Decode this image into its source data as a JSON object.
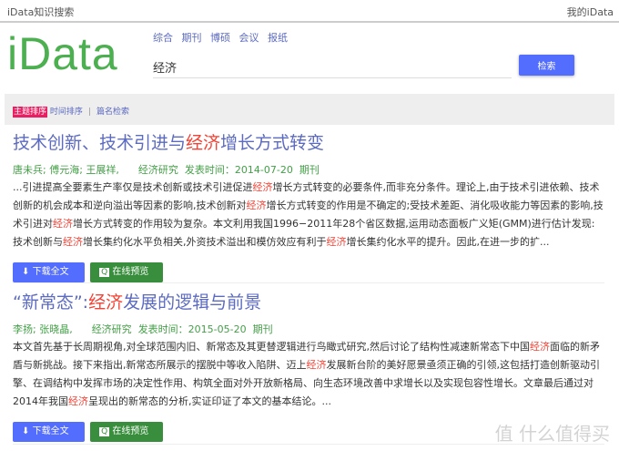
{
  "topbar": {
    "app_title": "iData知识搜索",
    "account": "我的iData"
  },
  "logo": "iData",
  "nav": [
    "综合",
    "期刊",
    "博硕",
    "会议",
    "报纸"
  ],
  "search": {
    "value": "经济",
    "button": "检索"
  },
  "sort": {
    "active": "主题排序",
    "time": "时间排序",
    "sep": "|",
    "title_search": "篇名检索"
  },
  "buttons": {
    "download": "下载全文",
    "preview": "在线预览"
  },
  "results": [
    {
      "title": [
        {
          "t": "技术创新、技术引进与"
        },
        {
          "t": "经济",
          "hl": true
        },
        {
          "t": "增长方式转变"
        }
      ],
      "authors": "唐未兵; 傅元海; 王展祥,",
      "journal": "经济研究",
      "date": "发表时间：2014-07-20",
      "type": "期刊",
      "abstract": [
        {
          "t": "...引进提高全要素生产率仅是技术创新或技术引进促进"
        },
        {
          "t": "经济",
          "hl": true
        },
        {
          "t": "增长方式转变的必要条件,而非充分条件。理论上,由于技术引进依赖、技术创新的机会成本和逆向溢出等因素的影响,技术创新对"
        },
        {
          "t": "经济",
          "hl": true
        },
        {
          "t": "增长方式转变的作用是不确定的;受技术差距、消化吸收能力等因素的影响,技术引进对"
        },
        {
          "t": "经济",
          "hl": true
        },
        {
          "t": "增长方式转变的作用较为复杂。本文利用我国1996−2011年28个省区数据,运用动态面板广义矩(GMM)进行估计发现:技术创新与"
        },
        {
          "t": "经济",
          "hl": true
        },
        {
          "t": "增长集约化水平负相关,外资技术溢出和模仿效应有利于"
        },
        {
          "t": "经济",
          "hl": true
        },
        {
          "t": "增长集约化水平的提升。因此,在进一步的扩..."
        }
      ]
    },
    {
      "title": [
        {
          "t": "“新常态”:"
        },
        {
          "t": "经济",
          "hl": true
        },
        {
          "t": "发展的逻辑与前景"
        }
      ],
      "authors": "李扬; 张晓晶,",
      "journal": "经济研究",
      "date": "发表时间：2015-05-20",
      "type": "期刊",
      "abstract": [
        {
          "t": "本文首先基于长周期视角,对全球范围内旧、新常态及其更替逻辑进行鸟瞰式研究,然后讨论了结构性减速新常态下中国"
        },
        {
          "t": "经济",
          "hl": true
        },
        {
          "t": "面临的新矛盾与新挑战。接下来指出,新常态所展示的摆脱中等收入陷阱、迈上"
        },
        {
          "t": "经济",
          "hl": true
        },
        {
          "t": "发展新台阶的美好愿景亟须正确的引领,这包括打造创新驱动引擎、在调结构中发挥市场的决定性作用、构筑全面对外开放新格局、向生态环境改善中求增长以及实现包容性增长。文章最后通过对2014年我国"
        },
        {
          "t": "经济",
          "hl": true
        },
        {
          "t": "呈现出的新常态的分析,实证印证了本文的基本结论。..."
        }
      ]
    }
  ],
  "watermark": "值 什么值得买"
}
